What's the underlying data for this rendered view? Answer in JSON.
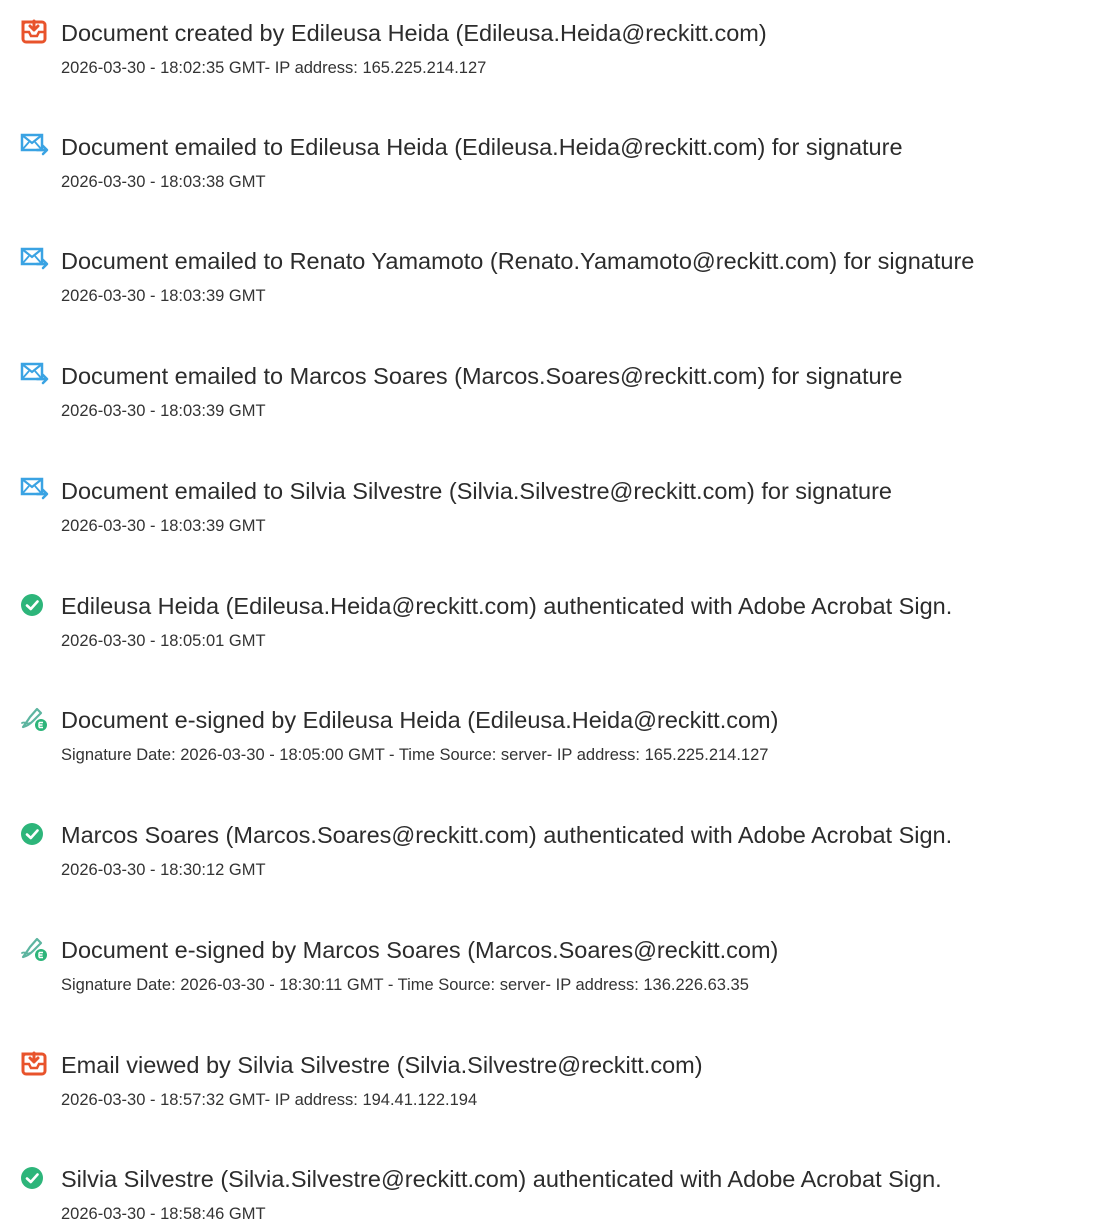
{
  "colors": {
    "doc_icon": "#E8532B",
    "mail_icon": "#3AA3E3",
    "check_icon": "#2DB57A",
    "esign_icon": "#5DB5A0"
  },
  "events": [
    {
      "icon": "document-icon",
      "title": "Document created by Edileusa Heida (Edileusa.Heida@reckitt.com)",
      "detail": "2026-03-30 - 18:02:35 GMT- IP address: 165.225.214.127"
    },
    {
      "icon": "email-sent-icon",
      "title": "Document emailed to Edileusa Heida (Edileusa.Heida@reckitt.com) for signature",
      "detail": "2026-03-30 - 18:03:38 GMT"
    },
    {
      "icon": "email-sent-icon",
      "title": "Document emailed to Renato Yamamoto (Renato.Yamamoto@reckitt.com) for signature",
      "detail": "2026-03-30 - 18:03:39 GMT"
    },
    {
      "icon": "email-sent-icon",
      "title": "Document emailed to Marcos Soares (Marcos.Soares@reckitt.com) for signature",
      "detail": "2026-03-30 - 18:03:39 GMT"
    },
    {
      "icon": "email-sent-icon",
      "title": "Document emailed to Silvia Silvestre (Silvia.Silvestre@reckitt.com) for signature",
      "detail": "2026-03-30 - 18:03:39 GMT"
    },
    {
      "icon": "check-circle-icon",
      "title": "Edileusa Heida (Edileusa.Heida@reckitt.com) authenticated with Adobe Acrobat Sign.",
      "detail": "2026-03-30 - 18:05:01 GMT"
    },
    {
      "icon": "esign-pen-icon",
      "title": "Document e-signed by Edileusa Heida (Edileusa.Heida@reckitt.com)",
      "detail": "Signature Date: 2026-03-30 - 18:05:00 GMT - Time Source: server- IP address: 165.225.214.127"
    },
    {
      "icon": "check-circle-icon",
      "title": "Marcos Soares (Marcos.Soares@reckitt.com) authenticated with Adobe Acrobat Sign.",
      "detail": "2026-03-30 - 18:30:12 GMT"
    },
    {
      "icon": "esign-pen-icon",
      "title": "Document e-signed by Marcos Soares (Marcos.Soares@reckitt.com)",
      "detail": "Signature Date: 2026-03-30 - 18:30:11 GMT - Time Source: server- IP address: 136.226.63.35"
    },
    {
      "icon": "document-icon",
      "title": "Email viewed by Silvia Silvestre (Silvia.Silvestre@reckitt.com)",
      "detail": "2026-03-30 - 18:57:32 GMT- IP address: 194.41.122.194"
    },
    {
      "icon": "check-circle-icon",
      "title": "Silvia Silvestre (Silvia.Silvestre@reckitt.com) authenticated with Adobe Acrobat Sign.",
      "detail": "2026-03-30 - 18:58:46 GMT"
    }
  ]
}
